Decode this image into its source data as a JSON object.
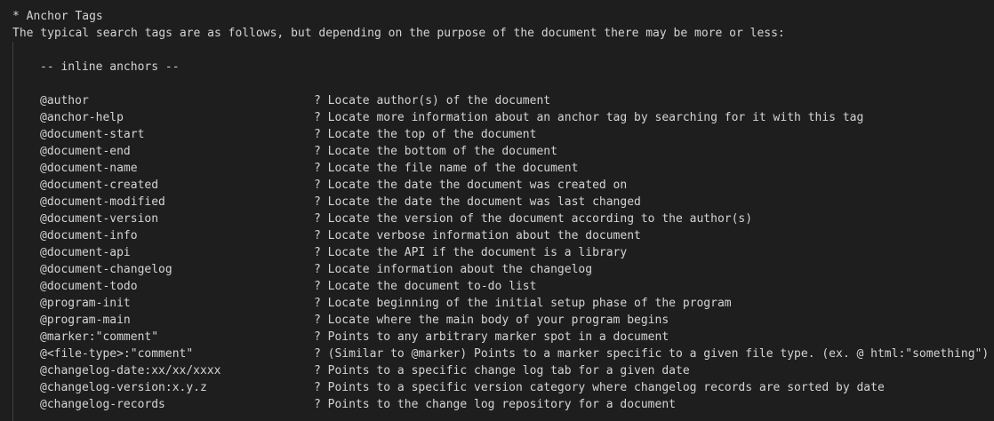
{
  "document": {
    "heading": "* Anchor Tags",
    "intro": "The typical search tags are as follows, but depending on the purpose of the document there may be more or less:",
    "section_title": "-- inline anchors --",
    "tags": [
      {
        "tag": "@author",
        "description": "? Locate author(s) of the document"
      },
      {
        "tag": "@anchor-help",
        "description": "? Locate more information about an anchor tag by searching for it with this tag"
      },
      {
        "tag": "@document-start",
        "description": "? Locate the top of the document"
      },
      {
        "tag": "@document-end",
        "description": "? Locate the bottom of the document"
      },
      {
        "tag": "@document-name",
        "description": "? Locate the file name of the document"
      },
      {
        "tag": "@document-created",
        "description": "? Locate the date the document was created on"
      },
      {
        "tag": "@document-modified",
        "description": "? Locate the date the document was last changed"
      },
      {
        "tag": "@document-version",
        "description": "? Locate the version of the document according to the author(s)"
      },
      {
        "tag": "@document-info",
        "description": "? Locate verbose information about the document"
      },
      {
        "tag": "@document-api",
        "description": "? Locate the API if the document is a library"
      },
      {
        "tag": "@document-changelog",
        "description": "? Locate information about the changelog"
      },
      {
        "tag": "@document-todo",
        "description": "? Locate the document to-do list"
      },
      {
        "tag": "@program-init",
        "description": "? Locate beginning of the initial setup phase of the program"
      },
      {
        "tag": "@program-main",
        "description": "? Locate where the main body of your program begins"
      },
      {
        "tag": "@marker:\"comment\"",
        "description": "? Points to any arbitrary marker spot in a document"
      },
      {
        "tag": "@<file-type>:\"comment\"",
        "description": "? (Similar to @marker) Points to a marker specific to a given file type. (ex. @ html:\"something\")"
      },
      {
        "tag": "@changelog-date:xx/xx/xxxx",
        "description": "? Points to a specific change log tab for a given date"
      },
      {
        "tag": "@changelog-version:x.y.z",
        "description": "? Points to a specific version category where changelog records are sorted by date"
      },
      {
        "tag": "@changelog-records",
        "description": "? Points to the change log repository for a document"
      }
    ]
  },
  "colors": {
    "background": "#1e1e1e",
    "text": "#d4d4d4",
    "indent_guide": "#404040"
  }
}
